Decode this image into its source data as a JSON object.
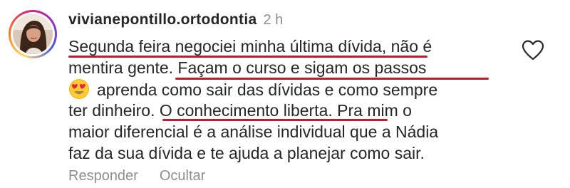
{
  "comment": {
    "username": "vivianepontillo.ortodontia",
    "time": "2 h",
    "lines": [
      "Segunda feira negociei minha última dívida, não é",
      "mentira gente. Façam o curso e sigam os passos",
      "aprenda como sair das dívidas e como sempre",
      "ter dinheiro. O conhecimento liberta. Pra mim o",
      "maior diferencial é a análise individual que a Nádia",
      "faz da sua dívida e te ajuda a planejar como sair."
    ],
    "emoji": "heart-eyes-emoji-icon",
    "actions": {
      "reply_label": "Responder",
      "hide_label": "Ocultar"
    },
    "like_icon": "heart-outline-icon"
  },
  "colors": {
    "annotation_underline": "#b8202f",
    "secondary_text": "#8e8e8e",
    "primary_text": "#262626"
  }
}
